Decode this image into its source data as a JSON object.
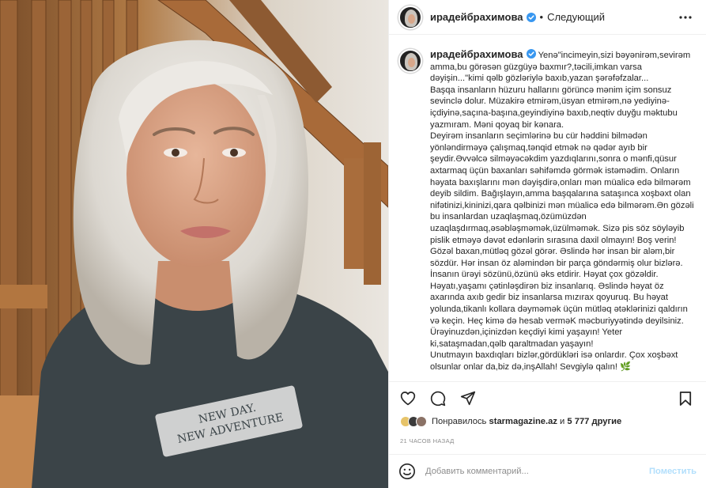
{
  "header": {
    "username": "ирадейбрахимова",
    "separator": "•",
    "follow_label": "Следующий",
    "more_icon": "more-horizontal-icon"
  },
  "caption": {
    "username": "ирадейбрахимова",
    "text": "Yenə\"incimeyin,sizi bəyənirəm,sevirəm amma,bu görəsən güzgüyə baxmır?,təcili,imkan varsa dəyişin...\"kimi qəlb gözləriylə baxıb,yazan şərəfəfzalar...\nBaşqa insanların hüzuru hallarını görüncə mənim içim sonsuz sevinclə dolur. Müzakirə etmirəm,üsyan etmirəm,nə yediyinə-içdiyinə,saçına-başına,geyindiyinə baxıb,neqtiv duyğu məktubu yazmıram. Məni qoyaq bir kənara.\nDeyirəm insanların seçimlərinə bu cür həddini bilmədən yönləndirməyə çalışmaq,tənqid etmək nə qədər ayıb bir şeydir.Əvvəlcə silməyəcəkdim yazdıqlarını,sonra o mənfi,qüsur axtarmaq üçün baxanları səhifəmdə görmək istəmədim. Onların həyata baxışlarını mən dəyişdirə,onları mən müalicə edə bilmərəm deyib sildim. Bağışlayın,amma başqalarına sataşınca xoşbəxt olan nifətinizi,kininizi,qara qəlbinizi mən müalicə edə bilmərəm.Ən gözəli bu insanlardan uzaqlaşmaq,özümüzdən uzaqlaşdırmaq,əsəbləşməmək,üzülməmək. Sizə pis söz söyləyib pislik etməyə dəvət edənlərin sırasına daxil olmayın! Boş verin! Gözəl baxan,mütləq gözəl görər. Əslində hər insan bir aləm,bir sözdür. Hər insan öz aləmindən bir parça göndərmiş olur bizlərə. İnsanın ürəyi sözünü,özünü əks etdirir. Həyat çox gözəldir. Həyatı,yaşamı çətinləşdirən biz insanlarıq. Əslində həyat öz axarında axıb gedir biz insanlarsa mızırax qoyuruq. Bu həyat yolunda,tikanlı kollara dəyməmək üçün mütləq ətəklərinizi qaldırın və keçin. Heç kimə də hesab verməK məcburiyyətində deyilsiniz.\nÜrəyinuzdən,içinizdən keçdiyi kimi yaşayın! Yeter ki,sataşmadan,qəlb qaraltmadan yaşayın!\nUnutmayın baxdıqları bizlər,gördükləri isə onlardır. Çox xoşbəxt olsunlar onlar da,biz də,inşAllah! Sevgiylə qalın! 🌿"
  },
  "actions": {
    "like_icon": "heart-icon",
    "comment_icon": "comment-icon",
    "share_icon": "share-icon",
    "save_icon": "bookmark-icon"
  },
  "likes": {
    "prefix": "Понравилось",
    "user": "starmagazine.az",
    "middle": "и",
    "count": "5 777 другие"
  },
  "timestamp": "21 ЧАСОВ НАЗАД",
  "comment": {
    "emoji_icon": "emoji-icon",
    "placeholder": "Добавить комментарий...",
    "post_label": "Поместить"
  },
  "photo": {
    "shirt_text_line1": "NEW DAY.",
    "shirt_text_line2": "NEW ADVENTURE"
  },
  "colors": {
    "verified": "#3897f0",
    "post_button_disabled": "#b2dffc",
    "muted": "#8e8e8e",
    "border": "#efefef"
  }
}
